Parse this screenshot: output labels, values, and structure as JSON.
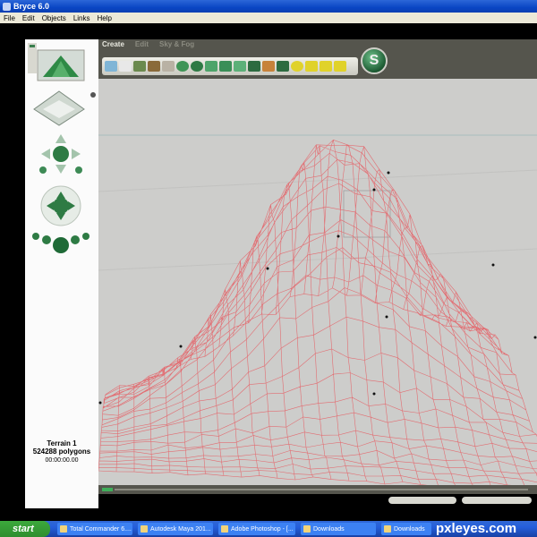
{
  "window": {
    "title": "Bryce 6.0"
  },
  "menu": [
    "File",
    "Edit",
    "Objects",
    "Links",
    "Help"
  ],
  "tabs": [
    {
      "label": "Create"
    },
    {
      "label": "Edit"
    },
    {
      "label": "Sky & Fog"
    }
  ],
  "colors": {
    "toolbar": "#55554d",
    "viewport": "#cdcdcb",
    "wireframe": "#e26d72",
    "guide": "#a9bdbd"
  },
  "status": {
    "object_name": "Terrain 1",
    "polygons": "524288 polygons",
    "time": "00:00:00.00"
  },
  "taskbar": {
    "start": "start",
    "items": [
      {
        "label": "Total Commander 6...."
      },
      {
        "label": "Autodesk Maya 201..."
      },
      {
        "label": "Adobe Photoshop - [..."
      },
      {
        "label": "Downloads"
      },
      {
        "label": "Downloads"
      }
    ]
  },
  "watermark": "pxleyes.com"
}
